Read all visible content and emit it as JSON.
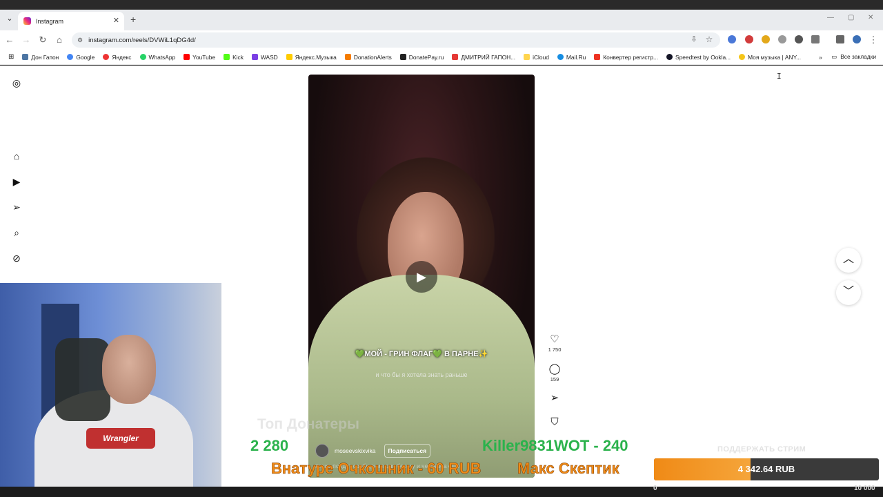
{
  "browser": {
    "tab_title": "Instagram",
    "url": "instagram.com/reels/DVWiL1qDG4d/",
    "bookmarks": [
      "Дон Гапон",
      "Google",
      "Яндекс",
      "WhatsApp",
      "YouTube",
      "Kick",
      "WASD",
      "Яндекс.Музыка",
      "DonationAlerts",
      "DonatePay.ru",
      "ДМИТРИЙ ГАПОН...",
      "iCloud",
      "Mail.Ru",
      "Конвертер регистр...",
      "Speedtest by Ookla...",
      "Моя музыка | ANY..."
    ],
    "all_bookmarks": "Все закладки",
    "colors": {
      "tabstrip": "#e9ebee",
      "omnibox": "#eef1f4"
    }
  },
  "reel": {
    "caption_main": "💚МОЙ - ГРИН ФЛАГ💚 В ПАРНЕ✨",
    "caption_sub": "и что бы я хотела знать  раньше",
    "author": "moseevskixvika",
    "follow_label": "Подписаться",
    "description": "Какие пойдут сообщения для берегу и человека ещё",
    "likes": "1 750",
    "comments": "159"
  },
  "stream_overlay": {
    "top_donators_title": "Топ Донатеры",
    "ticker_number": "2 280",
    "ticker_green": "Killer9831WOT - 240",
    "ticker_orange": "Внатуре Очкошник - 60 RUB",
    "ticker_orange2": "Макс Скептик",
    "support_label": "ПОДДЕРЖАТЬ СТРИМ",
    "donation_amount": "4 342.64 RUB",
    "donation_progress": 0.43,
    "goal_min": "0",
    "goal_max": "10 000",
    "colors": {
      "green": "#2bb24c",
      "orange": "#f08a16"
    }
  }
}
